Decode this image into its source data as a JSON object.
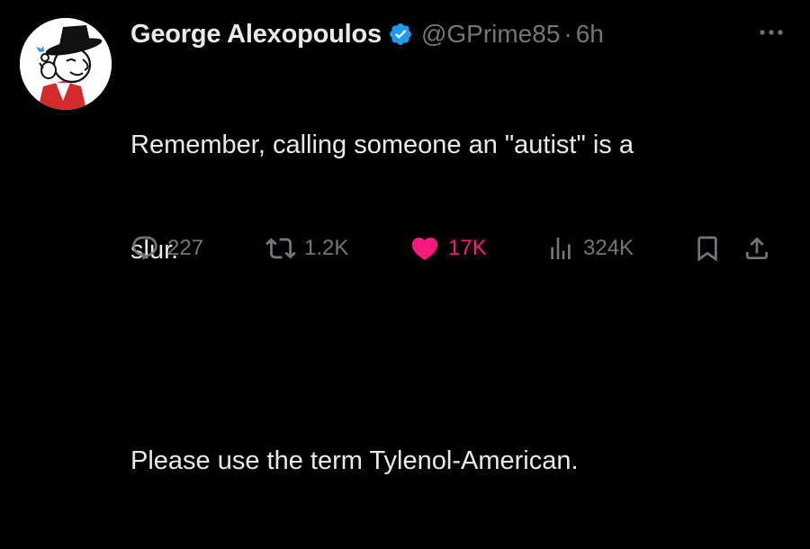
{
  "tweet": {
    "author": {
      "display_name": "George Alexopoulos",
      "handle": "@GPrime85",
      "verified": true,
      "avatar": "cartoon-man-with-wide-brim-hat-icon"
    },
    "separator": "·",
    "time": "6h",
    "body": {
      "line_1": "Remember, calling someone an \"autist\" is a",
      "line_2": "slur.",
      "line_3": "",
      "line_4": "Please use the term Tylenol-American."
    },
    "actions": {
      "replies": "227",
      "retweets": "1.2K",
      "likes": "17K",
      "views": "324K"
    },
    "liked": true
  },
  "colors": {
    "background": "#000000",
    "primary_text": "#e7e9ea",
    "secondary_text": "#71767b",
    "verified_badge": "#1d9bf0",
    "like_active": "#f91880"
  },
  "icons": {
    "more": "more-horizontal-icon",
    "verified": "verified-badge-icon",
    "reply": "reply-icon",
    "retweet": "retweet-icon",
    "like": "heart-filled-icon",
    "views": "views-bar-chart-icon",
    "bookmark": "bookmark-icon",
    "share": "share-icon"
  }
}
